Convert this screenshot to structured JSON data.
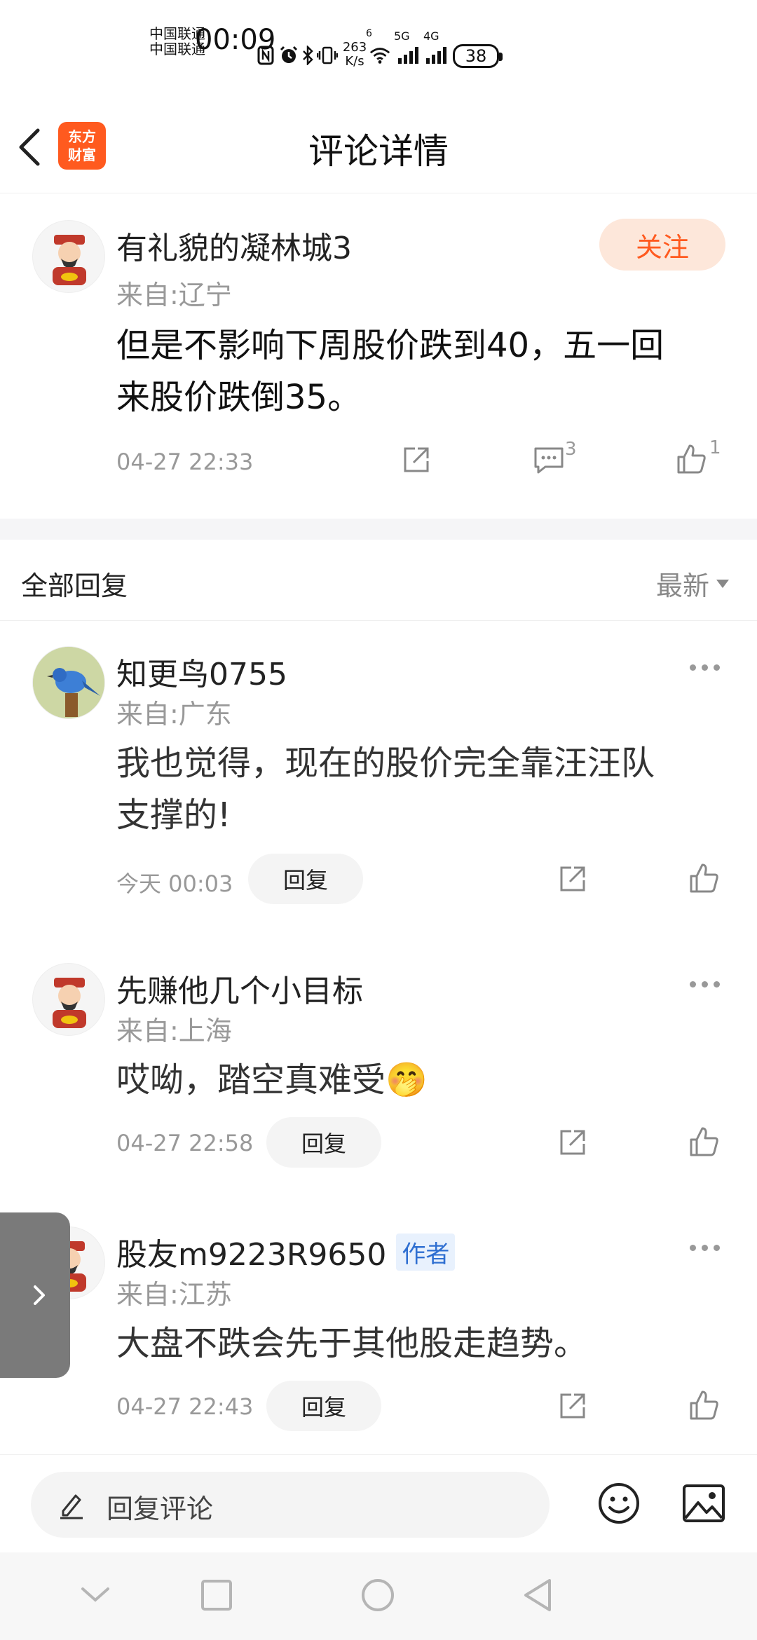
{
  "status_bar": {
    "carrier_1": "中国联通",
    "carrier_2": "中国联通",
    "time": "00:09",
    "net_speed_value": "263",
    "net_speed_unit": "K/s",
    "wifi_label": "6",
    "signal_1_label": "5G",
    "signal_2_label": "4G",
    "battery": "38"
  },
  "header": {
    "back_icon": "chevron-left-icon",
    "logo_line1": "东方",
    "logo_line2": "财富",
    "title": "评论详情"
  },
  "main_comment": {
    "username": "有礼貌的凝林城3",
    "location": "来自:辽宁",
    "follow_label": "关注",
    "text_line1": "但是不影响下周股价跌到40，五一回",
    "text_line2": "来股价跌倒35。",
    "time": "04-27 22:33",
    "comment_count": "3",
    "like_count": "1"
  },
  "replies_section": {
    "title": "全部回复",
    "sort_label": "最新"
  },
  "replies": [
    {
      "username": "知更鸟0755",
      "location": "来自:广东",
      "text_line1": "我也觉得，现在的股价完全靠汪汪队",
      "text_line2": "支撑的!",
      "time": "今天 00:03",
      "reply_label": "回复"
    },
    {
      "username": "先赚他几个小目标",
      "location": "来自:上海",
      "text_line1": "哎呦，踏空真难受🤭",
      "time": "04-27 22:58",
      "reply_label": "回复"
    },
    {
      "username": "股友m9223R9650",
      "author_badge": "作者",
      "location": "来自:江苏",
      "text_line1": "大盘不跌会先于其他股走趋势。",
      "time": "04-27 22:43",
      "reply_label": "回复"
    }
  ],
  "reply_bar": {
    "placeholder": "回复评论",
    "emoji_icon": "smiley-icon",
    "image_icon": "image-icon"
  },
  "colors": {
    "accent": "#ff5a1f",
    "follow_bg": "#fde7da",
    "author_badge": "#2f6fd1"
  }
}
